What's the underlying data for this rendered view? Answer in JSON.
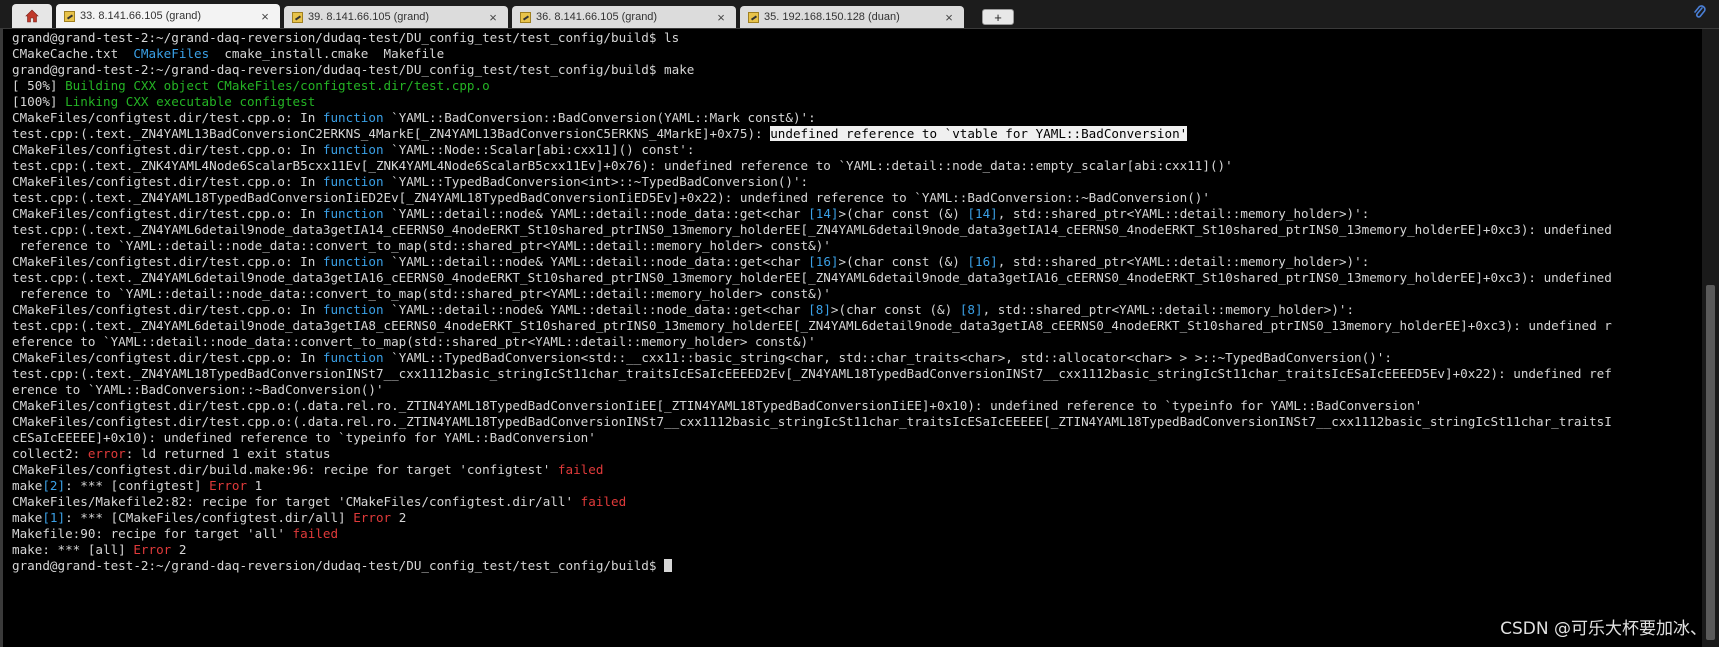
{
  "tabs": [
    {
      "label": "33. 8.141.66.105 (grand)",
      "active": true
    },
    {
      "label": "39. 8.141.66.105 (grand)",
      "active": false
    },
    {
      "label": "36. 8.141.66.105 (grand)",
      "active": false
    },
    {
      "label": "35. 192.168.150.128 (duan)",
      "active": false
    }
  ],
  "tab_close_glyph": "×",
  "new_tab_label": "+",
  "icons": {
    "home": "home-icon",
    "session": "terminal-session-icon",
    "attach": "paperclip-icon"
  },
  "colors": {
    "blue": "#3aa0e6",
    "green": "#24b324",
    "red": "#e03a3a",
    "text": "#d6d6d6"
  },
  "terminal": {
    "lines": [
      [
        {
          "t": "grand@grand-test-2:~/grand-daq-reversion/dudaq-test/DU_config_test/test_config/build$ ls"
        }
      ],
      [
        {
          "t": "CMakeCache.txt  "
        },
        {
          "t": "CMakeFiles",
          "c": "blue"
        },
        {
          "t": "  cmake_install.cmake  Makefile"
        }
      ],
      [
        {
          "t": "grand@grand-test-2:~/grand-daq-reversion/dudaq-test/DU_config_test/test_config/build$ make"
        }
      ],
      [
        {
          "t": "[ 50%] "
        },
        {
          "t": "Building CXX object CMakeFiles/configtest.dir/test.cpp.o",
          "c": "green"
        }
      ],
      [
        {
          "t": "[100%] "
        },
        {
          "t": "Linking CXX executable configtest",
          "c": "green"
        }
      ],
      [
        {
          "t": "CMakeFiles/configtest.dir/test.cpp.o: In "
        },
        {
          "t": "function",
          "c": "blue"
        },
        {
          "t": " `YAML::BadConversion::BadConversion(YAML::Mark const&)':"
        }
      ],
      [
        {
          "t": "test.cpp:(.text._ZN4YAML13BadConversionC2ERKNS_4MarkE[_ZN4YAML13BadConversionC5ERKNS_4MarkE]+0x75): "
        },
        {
          "t": "undefined reference to `vtable for YAML::BadConversion'",
          "c": "hl"
        }
      ],
      [
        {
          "t": "CMakeFiles/configtest.dir/test.cpp.o: In "
        },
        {
          "t": "function",
          "c": "blue"
        },
        {
          "t": " `YAML::Node::Scalar[abi:cxx11]() const':"
        }
      ],
      [
        {
          "t": "test.cpp:(.text._ZNK4YAML4Node6ScalarB5cxx11Ev[_ZNK4YAML4Node6ScalarB5cxx11Ev]+0x76): undefined reference to `YAML::detail::node_data::empty_scalar[abi:cxx11]()'"
        }
      ],
      [
        {
          "t": "CMakeFiles/configtest.dir/test.cpp.o: In "
        },
        {
          "t": "function",
          "c": "blue"
        },
        {
          "t": " `YAML::TypedBadConversion<int>::~TypedBadConversion()':"
        }
      ],
      [
        {
          "t": "test.cpp:(.text._ZN4YAML18TypedBadConversionIiED2Ev[_ZN4YAML18TypedBadConversionIiED5Ev]+0x22): undefined reference to `YAML::BadConversion::~BadConversion()'"
        }
      ],
      [
        {
          "t": "CMakeFiles/configtest.dir/test.cpp.o: In "
        },
        {
          "t": "function",
          "c": "blue"
        },
        {
          "t": " `YAML::detail::node& YAML::detail::node_data::get<char "
        },
        {
          "t": "[14]",
          "c": "blue"
        },
        {
          "t": ">(char const (&) "
        },
        {
          "t": "[14]",
          "c": "blue"
        },
        {
          "t": ", std::shared_ptr<YAML::detail::memory_holder>)':"
        }
      ],
      [
        {
          "t": "test.cpp:(.text._ZN4YAML6detail9node_data3getIA14_cEERNS0_4nodeERKT_St10shared_ptrINS0_13memory_holderEE[_ZN4YAML6detail9node_data3getIA14_cEERNS0_4nodeERKT_St10shared_ptrINS0_13memory_holderEE]+0xc3): undefined"
        }
      ],
      [
        {
          "t": " reference to `YAML::detail::node_data::convert_to_map(std::shared_ptr<YAML::detail::memory_holder> const&)'"
        }
      ],
      [
        {
          "t": "CMakeFiles/configtest.dir/test.cpp.o: In "
        },
        {
          "t": "function",
          "c": "blue"
        },
        {
          "t": " `YAML::detail::node& YAML::detail::node_data::get<char "
        },
        {
          "t": "[16]",
          "c": "blue"
        },
        {
          "t": ">(char const (&) "
        },
        {
          "t": "[16]",
          "c": "blue"
        },
        {
          "t": ", std::shared_ptr<YAML::detail::memory_holder>)':"
        }
      ],
      [
        {
          "t": "test.cpp:(.text._ZN4YAML6detail9node_data3getIA16_cEERNS0_4nodeERKT_St10shared_ptrINS0_13memory_holderEE[_ZN4YAML6detail9node_data3getIA16_cEERNS0_4nodeERKT_St10shared_ptrINS0_13memory_holderEE]+0xc3): undefined"
        }
      ],
      [
        {
          "t": " reference to `YAML::detail::node_data::convert_to_map(std::shared_ptr<YAML::detail::memory_holder> const&)'"
        }
      ],
      [
        {
          "t": "CMakeFiles/configtest.dir/test.cpp.o: In "
        },
        {
          "t": "function",
          "c": "blue"
        },
        {
          "t": " `YAML::detail::node& YAML::detail::node_data::get<char "
        },
        {
          "t": "[8]",
          "c": "blue"
        },
        {
          "t": ">(char const (&) "
        },
        {
          "t": "[8]",
          "c": "blue"
        },
        {
          "t": ", std::shared_ptr<YAML::detail::memory_holder>)':"
        }
      ],
      [
        {
          "t": "test.cpp:(.text._ZN4YAML6detail9node_data3getIA8_cEERNS0_4nodeERKT_St10shared_ptrINS0_13memory_holderEE[_ZN4YAML6detail9node_data3getIA8_cEERNS0_4nodeERKT_St10shared_ptrINS0_13memory_holderEE]+0xc3): undefined r"
        }
      ],
      [
        {
          "t": "eference to `YAML::detail::node_data::convert_to_map(std::shared_ptr<YAML::detail::memory_holder> const&)'"
        }
      ],
      [
        {
          "t": "CMakeFiles/configtest.dir/test.cpp.o: In "
        },
        {
          "t": "function",
          "c": "blue"
        },
        {
          "t": " `YAML::TypedBadConversion<std::__cxx11::basic_string<char, std::char_traits<char>, std::allocator<char> > >::~TypedBadConversion()':"
        }
      ],
      [
        {
          "t": "test.cpp:(.text._ZN4YAML18TypedBadConversionINSt7__cxx1112basic_stringIcSt11char_traitsIcESaIcEEEED2Ev[_ZN4YAML18TypedBadConversionINSt7__cxx1112basic_stringIcSt11char_traitsIcESaIcEEEED5Ev]+0x22): undefined ref"
        }
      ],
      [
        {
          "t": "erence to `YAML::BadConversion::~BadConversion()'"
        }
      ],
      [
        {
          "t": "CMakeFiles/configtest.dir/test.cpp.o:(.data.rel.ro._ZTIN4YAML18TypedBadConversionIiEE[_ZTIN4YAML18TypedBadConversionIiEE]+0x10): undefined reference to `typeinfo for YAML::BadConversion'"
        }
      ],
      [
        {
          "t": "CMakeFiles/configtest.dir/test.cpp.o:(.data.rel.ro._ZTIN4YAML18TypedBadConversionINSt7__cxx1112basic_stringIcSt11char_traitsIcESaIcEEEEE[_ZTIN4YAML18TypedBadConversionINSt7__cxx1112basic_stringIcSt11char_traitsI"
        }
      ],
      [
        {
          "t": "cESaIcEEEEE]+0x10): undefined reference to `typeinfo for YAML::BadConversion'"
        }
      ],
      [
        {
          "t": "collect2: "
        },
        {
          "t": "error",
          "c": "red"
        },
        {
          "t": ": ld returned 1 exit status"
        }
      ],
      [
        {
          "t": "CMakeFiles/configtest.dir/build.make:96: recipe for target 'configtest' "
        },
        {
          "t": "failed",
          "c": "red"
        }
      ],
      [
        {
          "t": "make"
        },
        {
          "t": "[2]",
          "c": "blue"
        },
        {
          "t": ": *** [configtest] "
        },
        {
          "t": "Error",
          "c": "red"
        },
        {
          "t": " 1"
        }
      ],
      [
        {
          "t": "CMakeFiles/Makefile2:82: recipe for target 'CMakeFiles/configtest.dir/all' "
        },
        {
          "t": "failed",
          "c": "red"
        }
      ],
      [
        {
          "t": "make"
        },
        {
          "t": "[1]",
          "c": "blue"
        },
        {
          "t": ": *** [CMakeFiles/configtest.dir/all] "
        },
        {
          "t": "Error",
          "c": "red"
        },
        {
          "t": " 2"
        }
      ],
      [
        {
          "t": "Makefile:90: recipe for target 'all' "
        },
        {
          "t": "failed",
          "c": "red"
        }
      ],
      [
        {
          "t": "make: *** [all] "
        },
        {
          "t": "Error",
          "c": "red"
        },
        {
          "t": " 2"
        }
      ],
      [
        {
          "t": "grand@grand-test-2:~/grand-daq-reversion/dudaq-test/DU_config_test/test_config/build$ "
        },
        {
          "t": "",
          "c": "cursor"
        }
      ]
    ]
  },
  "watermark": "CSDN @可乐大杯要加冰、"
}
